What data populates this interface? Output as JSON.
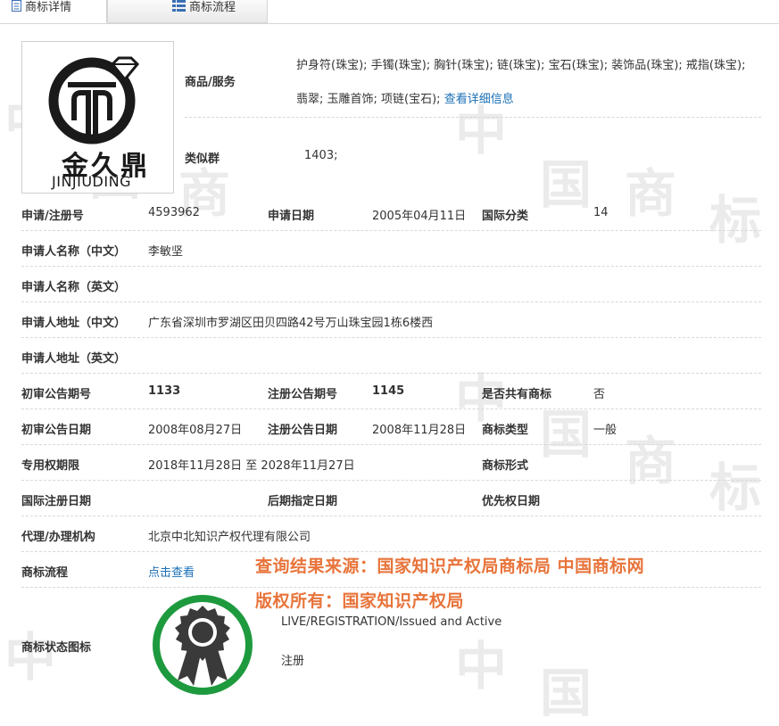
{
  "tabs": [
    {
      "label": "商标详情"
    },
    {
      "label": "商标流程"
    }
  ],
  "logo": {
    "brand_cn": "金久鼎",
    "brand_en": "JINJIUDING"
  },
  "goods": {
    "label": "商品/服务",
    "line1": "护身符(珠宝); 手镯(珠宝); 胸针(珠宝); 链(珠宝); 宝石(珠宝); 装饰品(珠宝); 戒指(珠宝);",
    "line2": "翡翠; 玉雕首饰; 项链(宝石);",
    "detail_link": "查看详细信息"
  },
  "similar_group": {
    "label": "类似群",
    "value": "1403;"
  },
  "fields": {
    "reg_no": {
      "label": "申请/注册号",
      "value": "4593962"
    },
    "apply_date": {
      "label": "申请日期",
      "value": "2005年04月11日"
    },
    "intl_class": {
      "label": "国际分类",
      "value": "14"
    },
    "applicant_cn": {
      "label": "申请人名称（中文）",
      "value": "李敏坚"
    },
    "applicant_en": {
      "label": "申请人名称（英文）",
      "value": ""
    },
    "address_cn": {
      "label": "申请人地址（中文）",
      "value": "广东省深圳市罗湖区田贝四路42号万山珠宝园1栋6楼西"
    },
    "address_en": {
      "label": "申请人地址（英文）",
      "value": ""
    },
    "prelim_no": {
      "label": "初审公告期号",
      "value": "1133"
    },
    "reg_pub_no": {
      "label": "注册公告期号",
      "value": "1145"
    },
    "shared": {
      "label": "是否共有商标",
      "value": "否"
    },
    "prelim_date": {
      "label": "初审公告日期",
      "value": "2008年08月27日"
    },
    "reg_pub_date": {
      "label": "注册公告日期",
      "value": "2008年11月28日"
    },
    "tm_type": {
      "label": "商标类型",
      "value": "一般"
    },
    "exclusive_period": {
      "label": "专用权期限",
      "value": "2018年11月28日 至 2028年11月27日"
    },
    "tm_form": {
      "label": "商标形式",
      "value": ""
    },
    "intl_reg_date": {
      "label": "国际注册日期",
      "value": ""
    },
    "later_date": {
      "label": "后期指定日期",
      "value": ""
    },
    "priority_date": {
      "label": "优先权日期",
      "value": ""
    },
    "agency": {
      "label": "代理/办理机构",
      "value": "北京中北知识产权代理有限公司"
    },
    "flow": {
      "label": "商标流程",
      "value": "点击查看"
    },
    "status_icon": {
      "label": "商标状态图标"
    }
  },
  "notice": {
    "line1": "查询结果来源：国家知识产权局商标局 中国商标网",
    "line2": "版权所有：国家知识产权局"
  },
  "status": {
    "en": "LIVE/REGISTRATION/Issued and Active",
    "cn": "注册"
  },
  "colors": {
    "link": "#1a6fb6",
    "notice": "#e8743b",
    "seal_ring": "#1e9a3e",
    "seal_badge": "#3a3a3a"
  }
}
